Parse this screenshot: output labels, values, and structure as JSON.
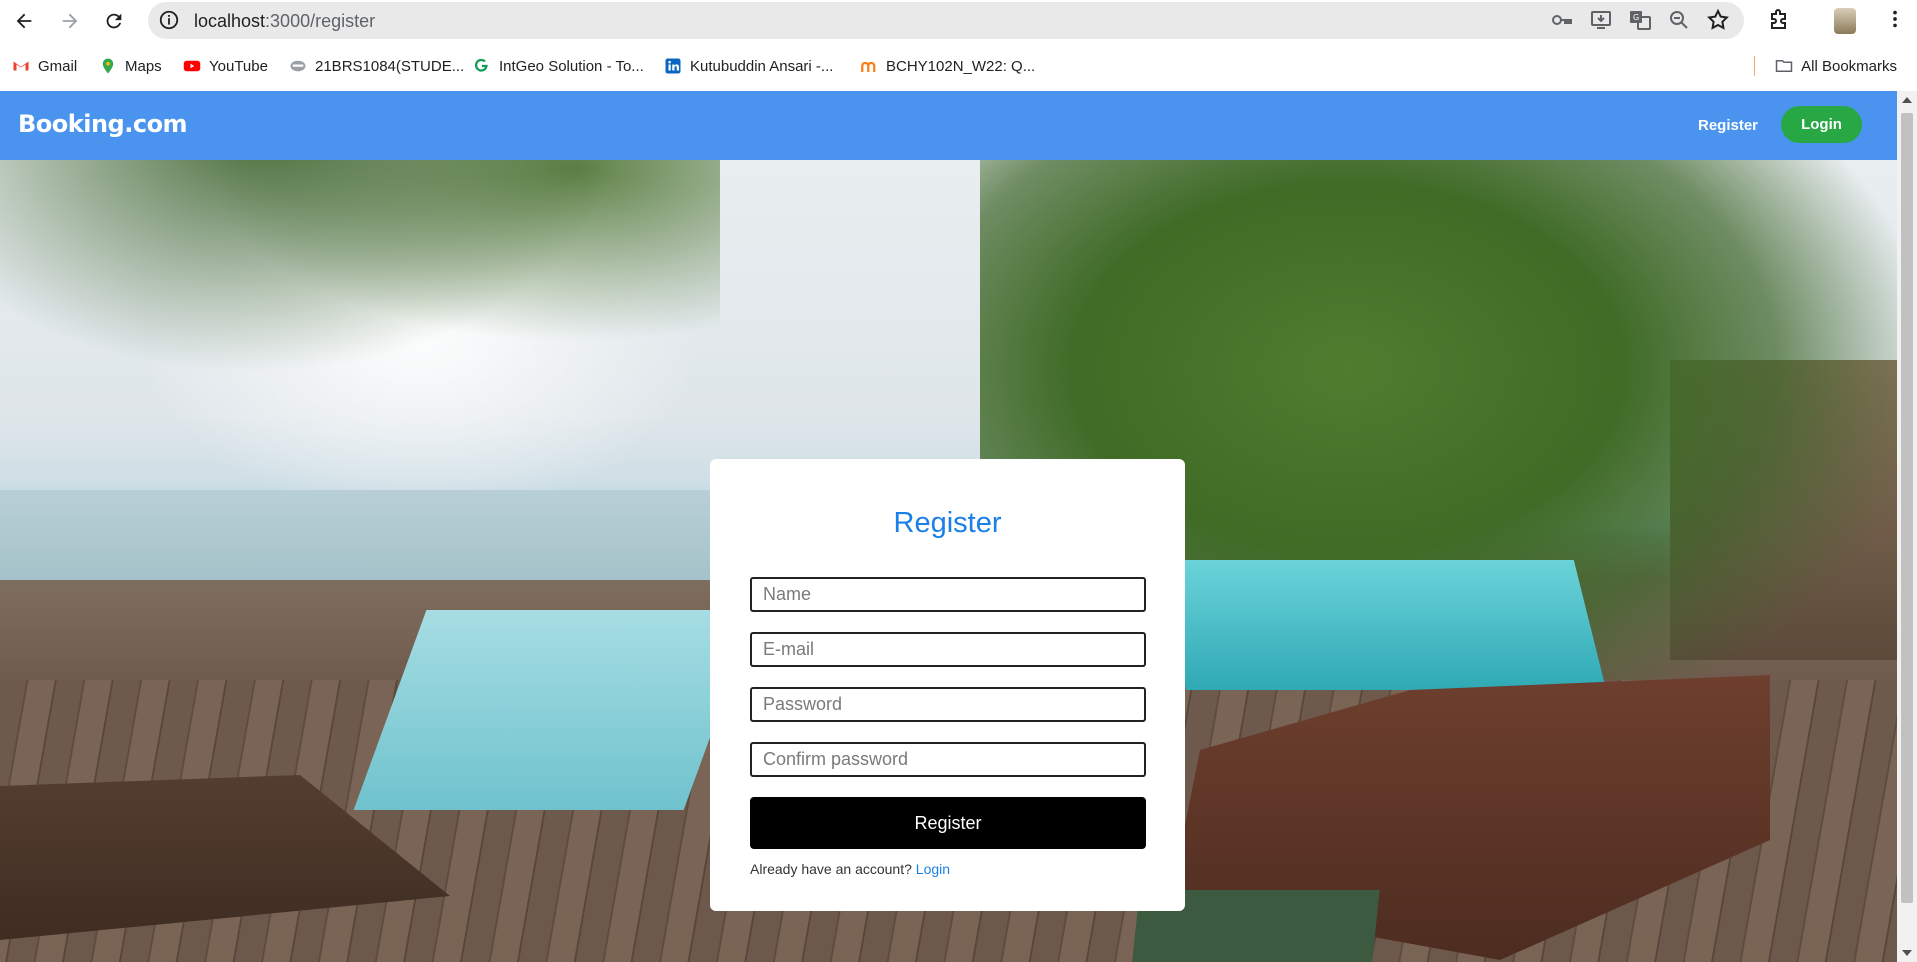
{
  "browser": {
    "url_host": "localhost",
    "url_rest": ":3000/register",
    "bookmarks": [
      {
        "label": "Gmail",
        "icon": "gmail-icon",
        "color": "#ea4335"
      },
      {
        "label": "Maps",
        "icon": "maps-icon",
        "color": "#34a853"
      },
      {
        "label": "YouTube",
        "icon": "youtube-icon",
        "color": "#ff0000"
      },
      {
        "label": "21BRS1084(STUDE...",
        "icon": "portal-icon",
        "color": "#9aa0a6"
      },
      {
        "label": "IntGeo Solution - To...",
        "icon": "intgeo-icon",
        "color": "#0f9d58"
      },
      {
        "label": "Kutubuddin Ansari -...",
        "icon": "linkedin-icon",
        "color": "#0a66c2"
      },
      {
        "label": "BCHY102N_W22: Q...",
        "icon": "moodle-icon",
        "color": "#f98012"
      }
    ],
    "all_bookmarks": "All Bookmarks"
  },
  "app": {
    "brand": "Booking.com",
    "nav_register": "Register",
    "nav_login": "Login",
    "colors": {
      "navbar": "#4a94ef",
      "login_button": "#27a844",
      "title": "#1a7fe6"
    }
  },
  "form": {
    "title": "Register",
    "name_placeholder": "Name",
    "email_placeholder": "E-mail",
    "password_placeholder": "Password",
    "confirm_placeholder": "Confirm password",
    "submit_label": "Register",
    "already_text": "Already have an account?",
    "login_link": "Login"
  }
}
